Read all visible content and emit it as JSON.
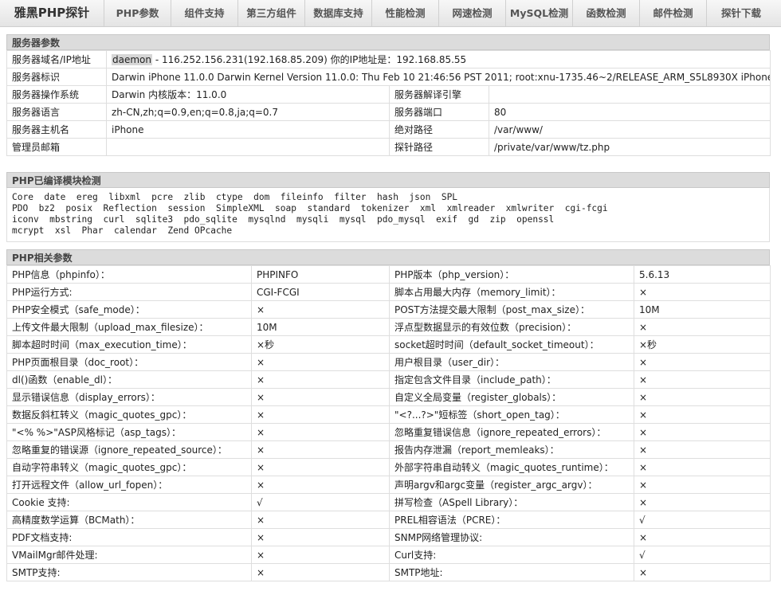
{
  "nav": {
    "brand": "雅黑PHP探针",
    "items": [
      "PHP参数",
      "组件支持",
      "第三方组件",
      "数据库支持",
      "性能检测",
      "网速检测",
      "MySQL检测",
      "函数检测",
      "邮件检测",
      "探针下载"
    ]
  },
  "server": {
    "title": "服务器参数",
    "domain_label": "服务器域名/IP地址",
    "domain_host": "daemon",
    "domain_rest": " - 116.252.156.231(192.168.85.209)  你的IP地址是：192.168.85.55",
    "id_label": "服务器标识",
    "id_value": "Darwin iPhone 11.0.0 Darwin Kernel Version 11.0.0: Thu Feb 10 21:46:56 PST 2011; root:xnu-1735.46~2/RELEASE_ARM_S5L8930X iPhone3,1",
    "os_label": "服务器操作系统",
    "os_value": "Darwin  内核版本：11.0.0",
    "engine_label": "服务器解译引擎",
    "engine_value": "",
    "lang_label": "服务器语言",
    "lang_value": "zh-CN,zh;q=0.9,en;q=0.8,ja;q=0.7",
    "port_label": "服务器端口",
    "port_value": "80",
    "host_label": "服务器主机名",
    "host_value": "iPhone",
    "abspath_label": "绝对路径",
    "abspath_value": "/var/www/",
    "admin_label": "管理员邮箱",
    "admin_value": "",
    "probe_label": "探针路径",
    "probe_value": "/private/var/www/tz.php"
  },
  "modules": {
    "title": "PHP已编译模块检测",
    "lines": [
      "Core  date  ereg  libxml  pcre  zlib  ctype  dom  fileinfo  filter  hash  json  SPL",
      "PDO  bz2  posix  Reflection  session  SimpleXML  soap  standard  tokenizer  xml  xmlreader  xmlwriter  cgi-fcgi",
      "iconv  mbstring  curl  sqlite3  pdo_sqlite  mysqlnd  mysqli  mysql  pdo_mysql  exif  gd  zip  openssl",
      "mcrypt  xsl  Phar  calendar  Zend OPcache"
    ]
  },
  "php": {
    "title": "PHP相关参数",
    "rows": [
      [
        {
          "l": "PHP信息（phpinfo）：",
          "v": "PHPINFO",
          "t": "grey"
        },
        {
          "l": "PHP版本（php_version）：",
          "v": "5.6.13",
          "t": "text"
        }
      ],
      [
        {
          "l": "PHP运行方式:",
          "v": "CGI-FCGI",
          "t": "text"
        },
        {
          "l": "脚本占用最大内存（memory_limit）：",
          "v": "×",
          "t": "no"
        }
      ],
      [
        {
          "l": "PHP安全模式（safe_mode）：",
          "v": "×",
          "t": "no"
        },
        {
          "l": "POST方法提交最大限制（post_max_size）：",
          "v": "10M",
          "t": "text"
        }
      ],
      [
        {
          "l": "上传文件最大限制（upload_max_filesize）：",
          "v": "10M",
          "t": "text"
        },
        {
          "l": "浮点型数据显示的有效位数（precision）：",
          "v": "×",
          "t": "no"
        }
      ],
      [
        {
          "l": "脚本超时时间（max_execution_time）：",
          "v": "×秒",
          "t": "nosec"
        },
        {
          "l": "socket超时时间（default_socket_timeout）：",
          "v": "×秒",
          "t": "nosec"
        }
      ],
      [
        {
          "l": "PHP页面根目录（doc_root）：",
          "v": "×",
          "t": "no"
        },
        {
          "l": "用户根目录（user_dir）：",
          "v": "×",
          "t": "no"
        }
      ],
      [
        {
          "l": "dl()函数（enable_dl）：",
          "v": "×",
          "t": "no"
        },
        {
          "l": "指定包含文件目录（include_path）：",
          "v": "×",
          "t": "no"
        }
      ],
      [
        {
          "l": "显示错误信息（display_errors）：",
          "v": "×",
          "t": "no"
        },
        {
          "l": "自定义全局变量（register_globals）：",
          "v": "×",
          "t": "no"
        }
      ],
      [
        {
          "l": "数据反斜杠转义（magic_quotes_gpc）：",
          "v": "×",
          "t": "no"
        },
        {
          "l": "\"<?...?>\"短标签（short_open_tag）：",
          "v": "×",
          "t": "no"
        }
      ],
      [
        {
          "l": "\"<% %>\"ASP风格标记（asp_tags）：",
          "v": "×",
          "t": "no"
        },
        {
          "l": "忽略重复错误信息（ignore_repeated_errors）：",
          "v": "×",
          "t": "no"
        }
      ],
      [
        {
          "l": "忽略重复的错误源（ignore_repeated_source）：",
          "v": "×",
          "t": "no"
        },
        {
          "l": "报告内存泄漏（report_memleaks）：",
          "v": "×",
          "t": "no"
        }
      ],
      [
        {
          "l": "自动字符串转义（magic_quotes_gpc）：",
          "v": "×",
          "t": "no"
        },
        {
          "l": "外部字符串自动转义（magic_quotes_runtime）：",
          "v": "×",
          "t": "no"
        }
      ],
      [
        {
          "l": "打开远程文件（allow_url_fopen）：",
          "v": "×",
          "t": "no"
        },
        {
          "l": "声明argv和argc变量（register_argc_argv）：",
          "v": "×",
          "t": "no"
        }
      ],
      [
        {
          "l": "Cookie 支持:",
          "v": "√",
          "t": "ok"
        },
        {
          "l": "拼写检查（ASpell Library）：",
          "v": "×",
          "t": "no"
        }
      ],
      [
        {
          "l": "高精度数学运算（BCMath）：",
          "v": "×",
          "t": "no"
        },
        {
          "l": "PREL相容语法（PCRE）：",
          "v": "√",
          "t": "ok"
        }
      ],
      [
        {
          "l": "PDF文档支持:",
          "v": "×",
          "t": "no"
        },
        {
          "l": "SNMP网络管理协议:",
          "v": "×",
          "t": "no"
        }
      ],
      [
        {
          "l": "VMailMgr邮件处理:",
          "v": "×",
          "t": "no"
        },
        {
          "l": "Curl支持:",
          "v": "√",
          "t": "ok"
        }
      ],
      [
        {
          "l": "SMTP支持:",
          "v": "×",
          "t": "no"
        },
        {
          "l": "SMTP地址:",
          "v": "×",
          "t": "no"
        }
      ]
    ]
  }
}
